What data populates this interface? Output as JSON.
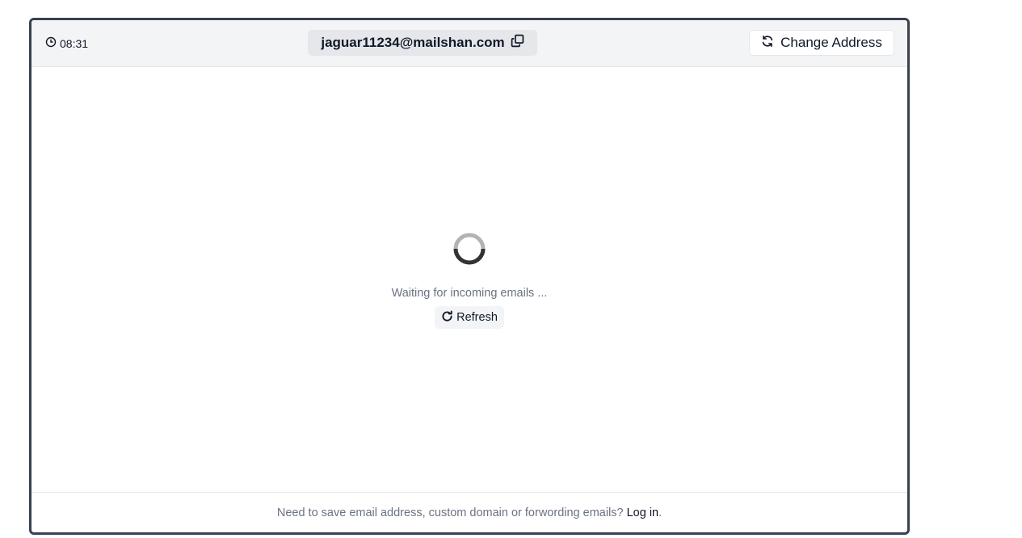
{
  "header": {
    "timer": "08:31",
    "email_address": "jaguar11234@mailshan.com",
    "change_address_label": "Change Address"
  },
  "inbox": {
    "status_text": "Waiting for incoming emails ...",
    "refresh_label": "Refresh"
  },
  "footer": {
    "prompt_text": "Need to save email address, custom domain or forwording emails?",
    "login_label": "Log in",
    "trailing_punct": "."
  },
  "icons": {
    "timer": "clock-icon",
    "copy": "copy-icon",
    "change": "refresh-arrows-icon",
    "refresh": "rotate-cw-icon",
    "loading": "spinner-icon"
  },
  "colors": {
    "frame_border": "#374151",
    "header_bg": "#f3f4f6",
    "muted_text": "#6b7280"
  }
}
